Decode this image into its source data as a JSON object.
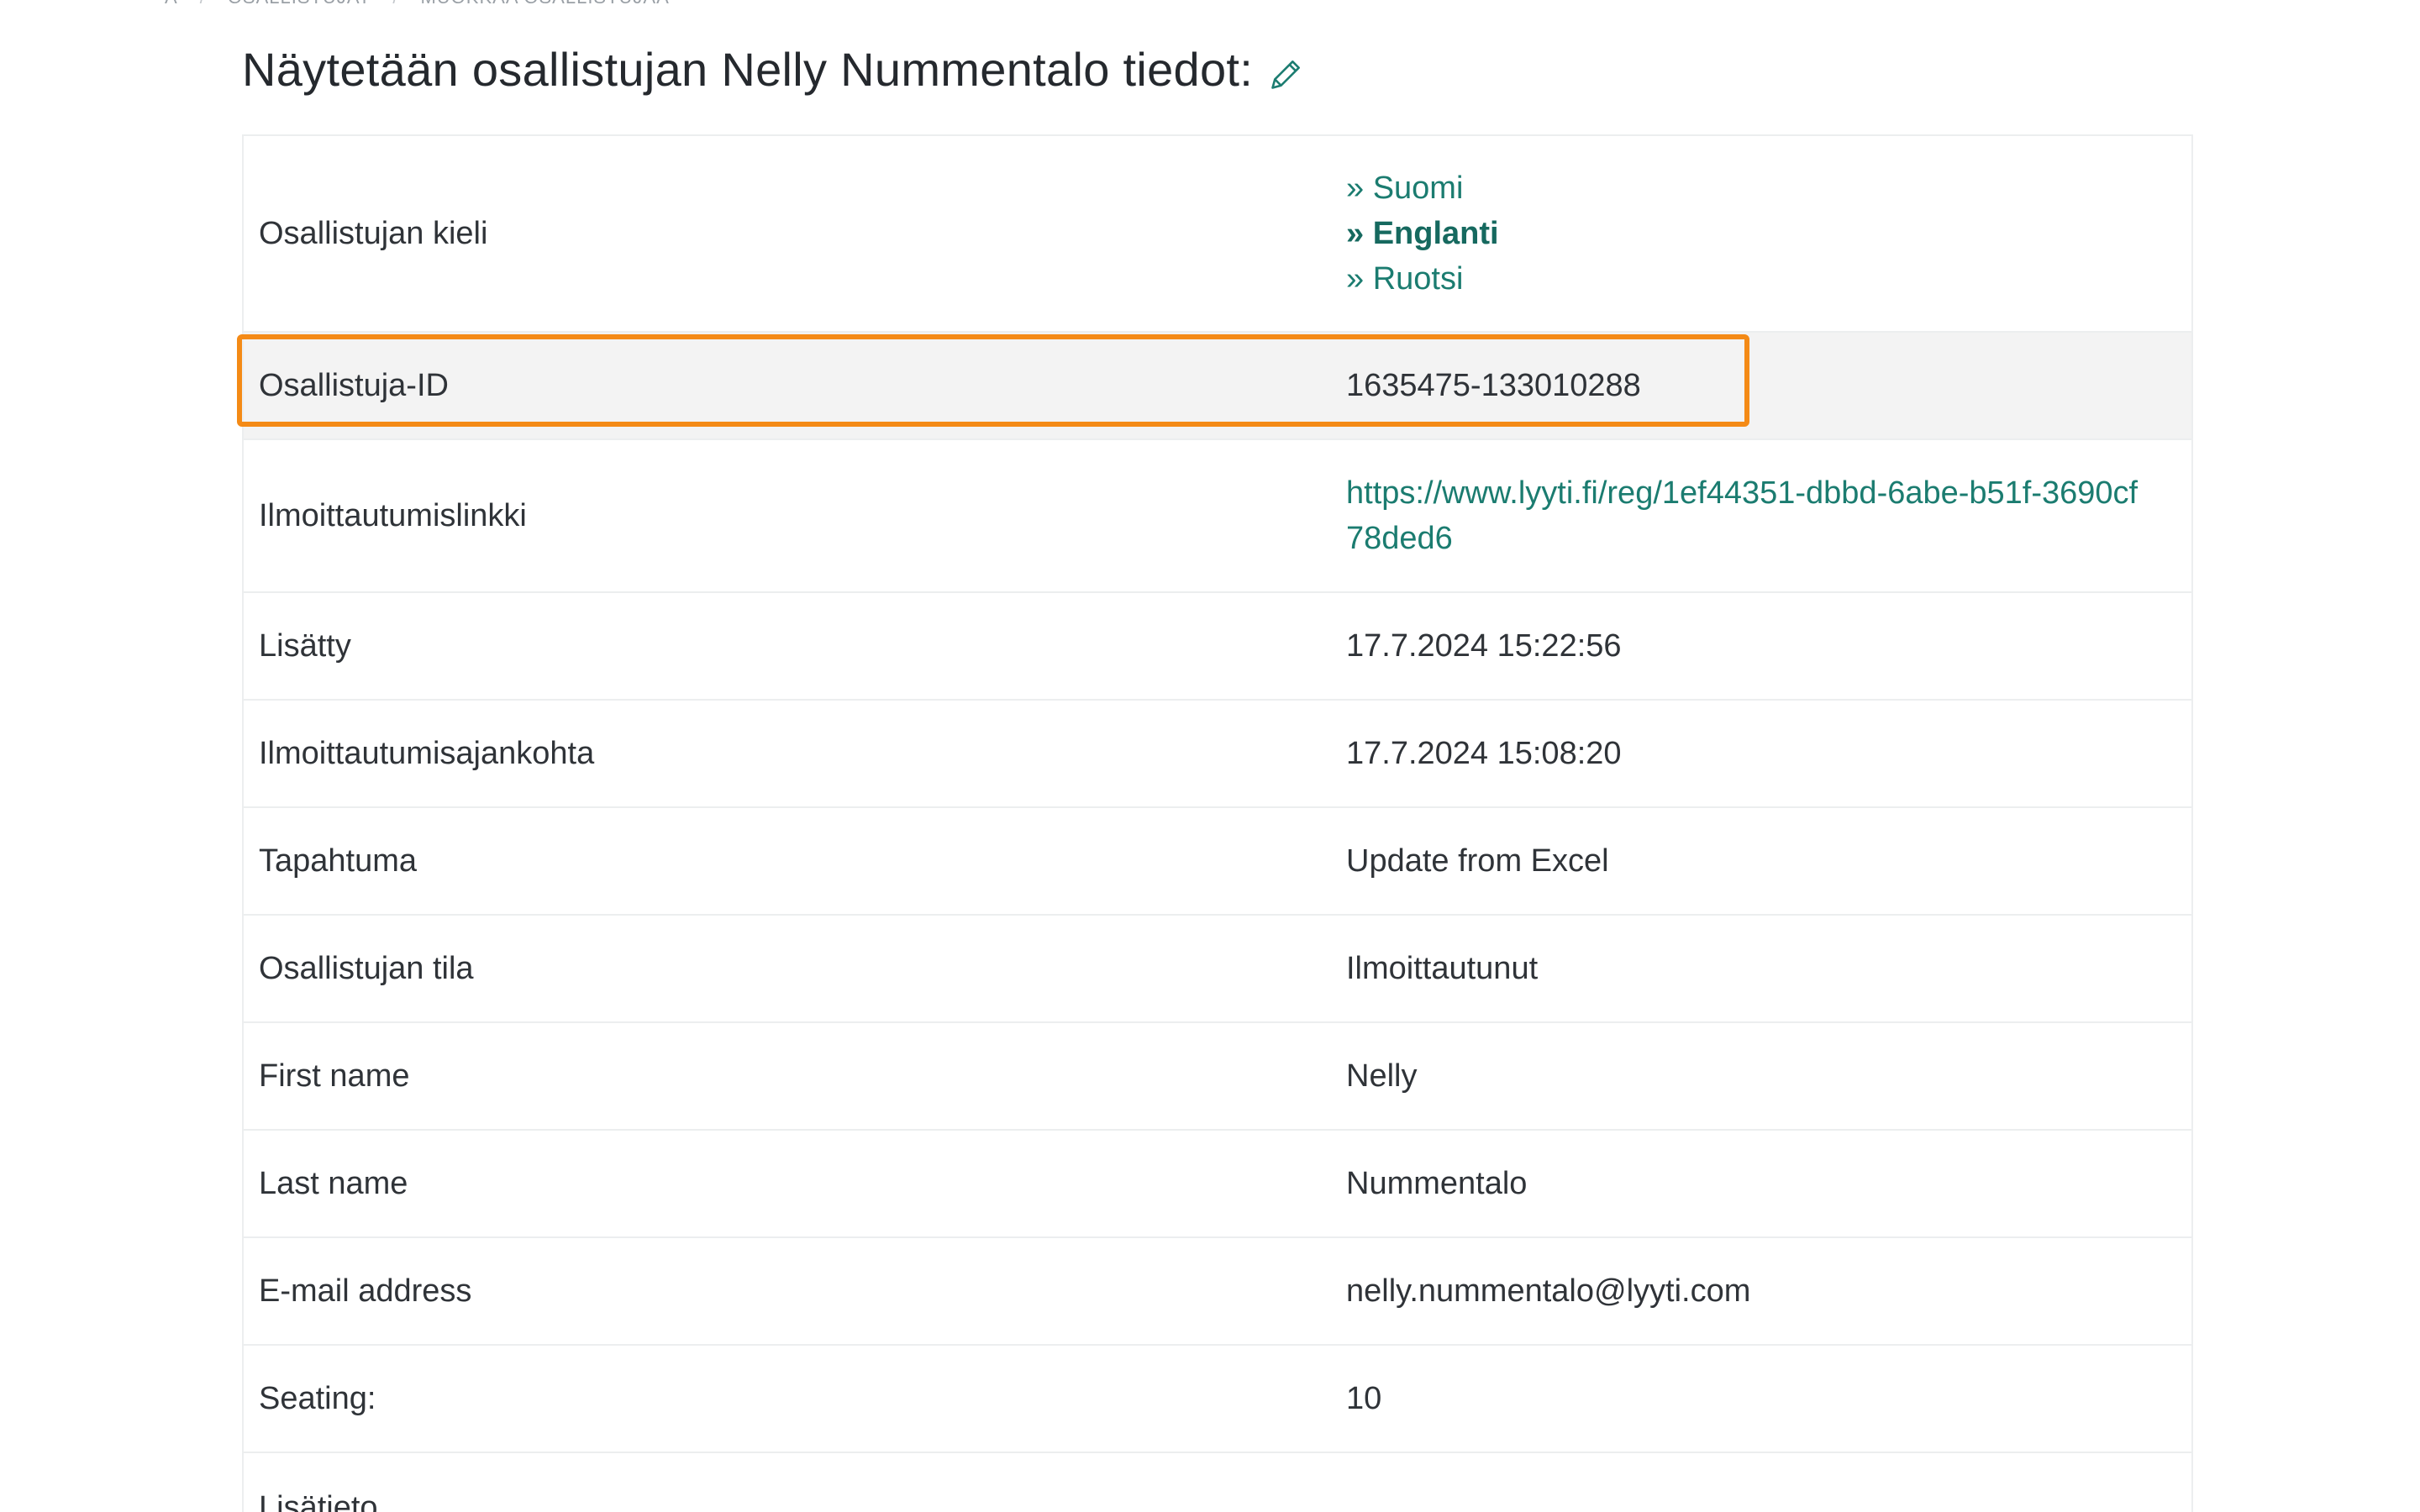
{
  "breadcrumb": [
    "A",
    "OSALLISTUJAT",
    "MUOKKAA OSALLISTUJAA"
  ],
  "header": {
    "title": "Näytetään osallistujan Nelly Nummentalo tiedot:",
    "edit_icon": "pencil-icon"
  },
  "language": {
    "label": "Osallistujan kieli",
    "options": [
      "» Suomi",
      "» Englanti",
      "» Ruotsi"
    ],
    "selected": "» Englanti"
  },
  "rows": {
    "participant_id": {
      "label": "Osallistuja-ID",
      "value": "1635475-133010288"
    },
    "registration_link": {
      "label": "Ilmoittautumislinkki",
      "value": "https://www.lyyti.fi/reg/1ef44351-dbbd-6abe-b51f-3690cf78ded6"
    },
    "added": {
      "label": "Lisätty",
      "value": "17.7.2024 15:22:56"
    },
    "registration_time": {
      "label": "Ilmoittautumisajankohta",
      "value": "17.7.2024 15:08:20"
    },
    "event": {
      "label": "Tapahtuma",
      "value": "Update from Excel"
    },
    "status": {
      "label": "Osallistujan tila",
      "value": "Ilmoittautunut"
    },
    "first_name": {
      "label": "First name",
      "value": "Nelly"
    },
    "last_name": {
      "label": "Last name",
      "value": "Nummentalo"
    },
    "email": {
      "label": "E-mail address",
      "value": "nelly.nummentalo@lyyti.com"
    },
    "seating": {
      "label": "Seating:",
      "value": "10"
    },
    "extra_info": {
      "label": "Lisätieto",
      "value": ""
    }
  },
  "colors": {
    "link": "#1b7c70",
    "highlight": "#f48a16",
    "row_shade": "#f3f3f3"
  }
}
